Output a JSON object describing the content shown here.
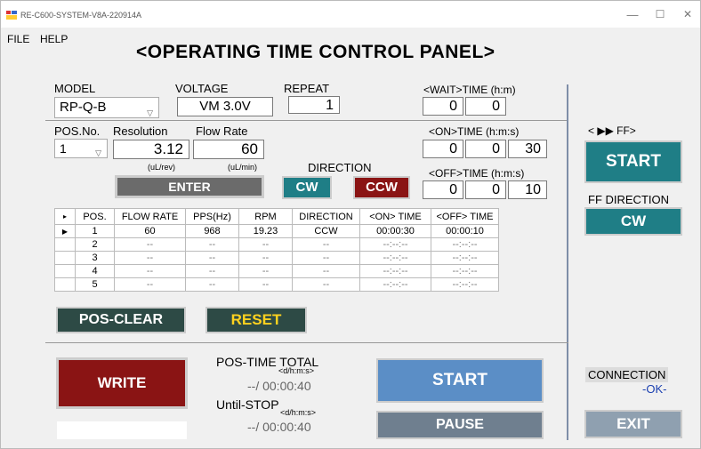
{
  "window": {
    "title": "RE-C600-SYSTEM-V8A-220914A",
    "minimize": "—",
    "maximize": "☐",
    "close": "✕"
  },
  "menu": {
    "file": "FILE",
    "help": "HELP"
  },
  "panel_title": "<OPERATING TIME  CONTROL PANEL>",
  "model": {
    "label": "MODEL",
    "value": "RP-Q-B"
  },
  "voltage": {
    "label": "VOLTAGE",
    "value": "VM 3.0V"
  },
  "repeat": {
    "label": "REPEAT",
    "value": "1"
  },
  "wait_time": {
    "label": "<WAIT>TIME (h:m)",
    "h": "0",
    "m": "0"
  },
  "pos_no": {
    "label": "POS.No.",
    "value": "1"
  },
  "resolution": {
    "label": "Resolution",
    "value": "3.12",
    "unit": "(uL/rev)"
  },
  "flow_rate": {
    "label": "Flow Rate",
    "value": "60",
    "unit": "(uL/min)"
  },
  "on_time": {
    "label": "<ON>TIME (h:m:s)",
    "h": "0",
    "m": "0",
    "s": "30"
  },
  "off_time": {
    "label": "<OFF>TIME (h:m:s)",
    "h": "0",
    "m": "0",
    "s": "10"
  },
  "direction": {
    "label": "DIRECTION",
    "cw": "CW",
    "ccw": "CCW"
  },
  "enter_button": "ENTER",
  "table": {
    "headers": [
      "▸",
      "POS.",
      "FLOW RATE",
      "PPS(Hz)",
      "RPM",
      "DIRECTION",
      "<ON> TIME",
      "<OFF> TIME"
    ],
    "rows": [
      [
        "▶",
        "1",
        "60",
        "968",
        "19.23",
        "CCW",
        "00:00:30",
        "00:00:10"
      ],
      [
        "",
        "2",
        "--",
        "--",
        "--",
        "--",
        "--:--:--",
        "--:--:--"
      ],
      [
        "",
        "3",
        "--",
        "--",
        "--",
        "--",
        "--:--:--",
        "--:--:--"
      ],
      [
        "",
        "4",
        "--",
        "--",
        "--",
        "--",
        "--:--:--",
        "--:--:--"
      ],
      [
        "",
        "5",
        "--",
        "--",
        "--",
        "--",
        "--:--:--",
        "--:--:--"
      ]
    ]
  },
  "pos_clear_button": "POS-CLEAR",
  "reset_button": "RESET",
  "write_button": "WRITE",
  "pos_time_total": {
    "label": "POS-TIME TOTAL",
    "unit": "<d/h:m:s>",
    "value": "--/ 00:00:40"
  },
  "until_stop": {
    "label": "Until-STOP",
    "unit": "<d/h:m:s>",
    "value": "--/ 00:00:40"
  },
  "start_main": "START",
  "pause_button": "PAUSE",
  "ff": {
    "label": "<  ▶▶ FF>",
    "start": "START",
    "dir_label": "FF DIRECTION",
    "dir_value": "CW"
  },
  "connection": {
    "label": "CONNECTION",
    "status": "-OK-"
  },
  "exit_button": "EXIT",
  "colors": {
    "teal": "#1f7e86",
    "darkred": "#8a1414",
    "gray_btn": "#6b6b6b",
    "blue": "#5b8ec6",
    "dark_slate": "#2d4a45"
  }
}
